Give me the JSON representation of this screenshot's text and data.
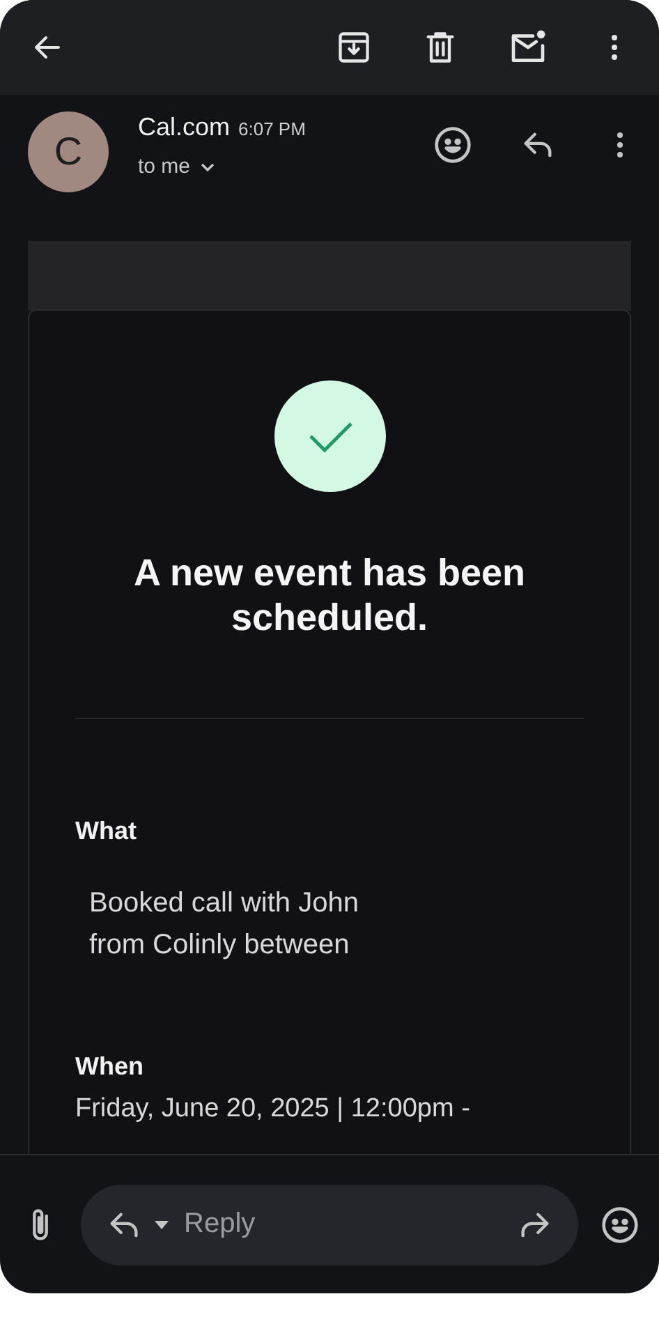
{
  "message": {
    "sender": "Cal.com",
    "avatar_letter": "C",
    "time": "6:07 PM",
    "recipient": "to me"
  },
  "email": {
    "title": "A new event has been scheduled.",
    "sections": [
      {
        "label": "What",
        "value": "Booked call with John from Colinly between",
        "kind": "indented"
      },
      {
        "label": "When",
        "value": "Friday, June 20, 2025 | 12:00pm -",
        "kind": "plain"
      }
    ]
  },
  "composer": {
    "placeholder": "Reply"
  }
}
